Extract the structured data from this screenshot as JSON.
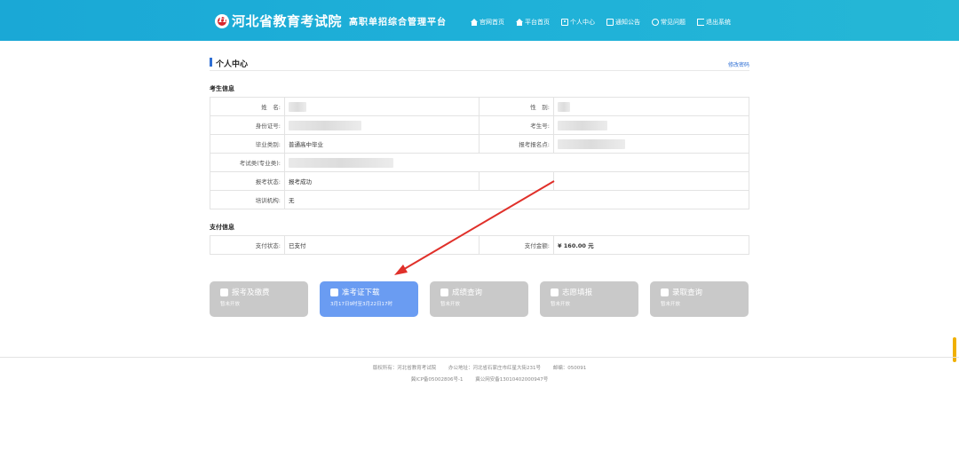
{
  "header": {
    "title": "河北省教育考试院",
    "subtitle": "高职单招综合管理平台",
    "nav": [
      {
        "label": "官网首页",
        "icon": "home-icon"
      },
      {
        "label": "平台首页",
        "icon": "home-icon"
      },
      {
        "label": "个人中心",
        "icon": "user-icon"
      },
      {
        "label": "通知公告",
        "icon": "document-icon"
      },
      {
        "label": "常见问题",
        "icon": "chat-icon"
      },
      {
        "label": "退出系统",
        "icon": "exit-icon"
      }
    ]
  },
  "page": {
    "title": "个人中心",
    "help_link": "修改密码"
  },
  "examinee": {
    "section_title": "考生信息",
    "rows": [
      {
        "l1": "姓　名:",
        "v1": "",
        "l2": "性　别:",
        "v2": ""
      },
      {
        "l1": "身份证号:",
        "v1": "",
        "l2": "考生号:",
        "v2": ""
      },
      {
        "l1": "毕业类别:",
        "v1": "普通高中毕业",
        "l2": "报考报名点:",
        "v2": ""
      },
      {
        "l1": "考试类(专业类):",
        "v1": ""
      },
      {
        "l1": "报考状态:",
        "v1": "报考成功",
        "l2": "",
        "v2": ""
      },
      {
        "l1": "培训机构:",
        "v1": "无"
      }
    ]
  },
  "payment": {
    "section_title": "支付信息",
    "status_label": "支付状态:",
    "status_value": "已支付",
    "amount_label": "支付金额:",
    "amount_value": "¥ 160.00 元"
  },
  "actions": [
    {
      "label": "报考及缴费",
      "sub": "暂未开放",
      "icon": "user-pay-icon",
      "active": false
    },
    {
      "label": "准考证下载",
      "sub": "3月17日9时至3月22日17时",
      "icon": "id-card-icon",
      "active": true
    },
    {
      "label": "成绩查询",
      "sub": "暂未开放",
      "icon": "star-icon",
      "active": false
    },
    {
      "label": "志愿填报",
      "sub": "暂未开放",
      "icon": "graduation-cap-icon",
      "active": false
    },
    {
      "label": "录取查询",
      "sub": "暂未开放",
      "icon": "inbox-icon",
      "active": false
    }
  ],
  "footer": {
    "line1": [
      "版权所有：河北省教育考试院",
      "办公地址：河北省石家庄市红星大街231号",
      "邮编：050091"
    ],
    "line2": [
      "冀ICP备05002806号-1",
      "冀公网安备13010402000947号"
    ]
  },
  "colors": {
    "header_bg": "#1fb1d8",
    "accent_blue": "#2f6fd4",
    "active_button": "#6a9cf2",
    "disabled_button": "#c9c9c9",
    "paid_green": "#3aa35a",
    "amount_red": "#e02020",
    "annotation_arrow": "#e0302a"
  }
}
